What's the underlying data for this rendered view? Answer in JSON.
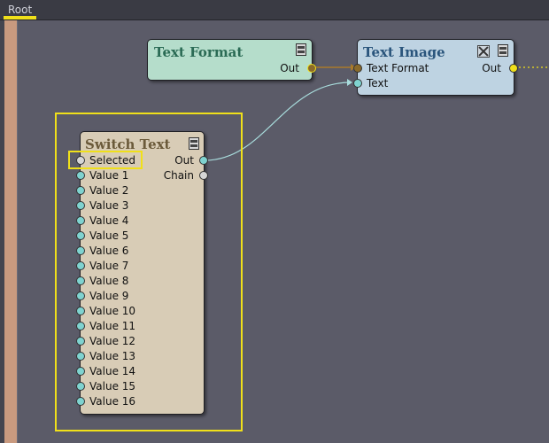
{
  "breadcrumb": {
    "root_label": "Root"
  },
  "nodes": {
    "text_format": {
      "title": "Text Format",
      "outputs": [
        "Out"
      ],
      "color": "#b5ddcb",
      "title_color": "#2b6b55"
    },
    "text_image": {
      "title": "Text Image",
      "inputs": [
        "Text Format",
        "Text"
      ],
      "outputs": [
        "Out"
      ],
      "color": "#bed3e2",
      "title_color": "#2a557c"
    },
    "switch_text": {
      "title": "Switch Text",
      "inputs": [
        "Selected",
        "Value 1",
        "Value 2",
        "Value 3",
        "Value 4",
        "Value 5",
        "Value 6",
        "Value 7",
        "Value 8",
        "Value 9",
        "Value 10",
        "Value 11",
        "Value 12",
        "Value 13",
        "Value 14",
        "Value 15",
        "Value 16"
      ],
      "outputs": [
        "Out",
        "Chain"
      ],
      "color": "#d8ccb6",
      "title_color": "#6b5a3a"
    }
  },
  "colors": {
    "canvas": "#5b5b68",
    "highlight": "#f0e01a",
    "wire_format": "#a97a2a",
    "wire_text": "#a8dcdc",
    "port_text": "#7fd3d0",
    "port_format": "#8a6a2a",
    "port_neutral": "#d6d6d6",
    "port_yellow": "#f0e01a"
  },
  "icons": [
    "node-menu-icon",
    "close-icon"
  ]
}
